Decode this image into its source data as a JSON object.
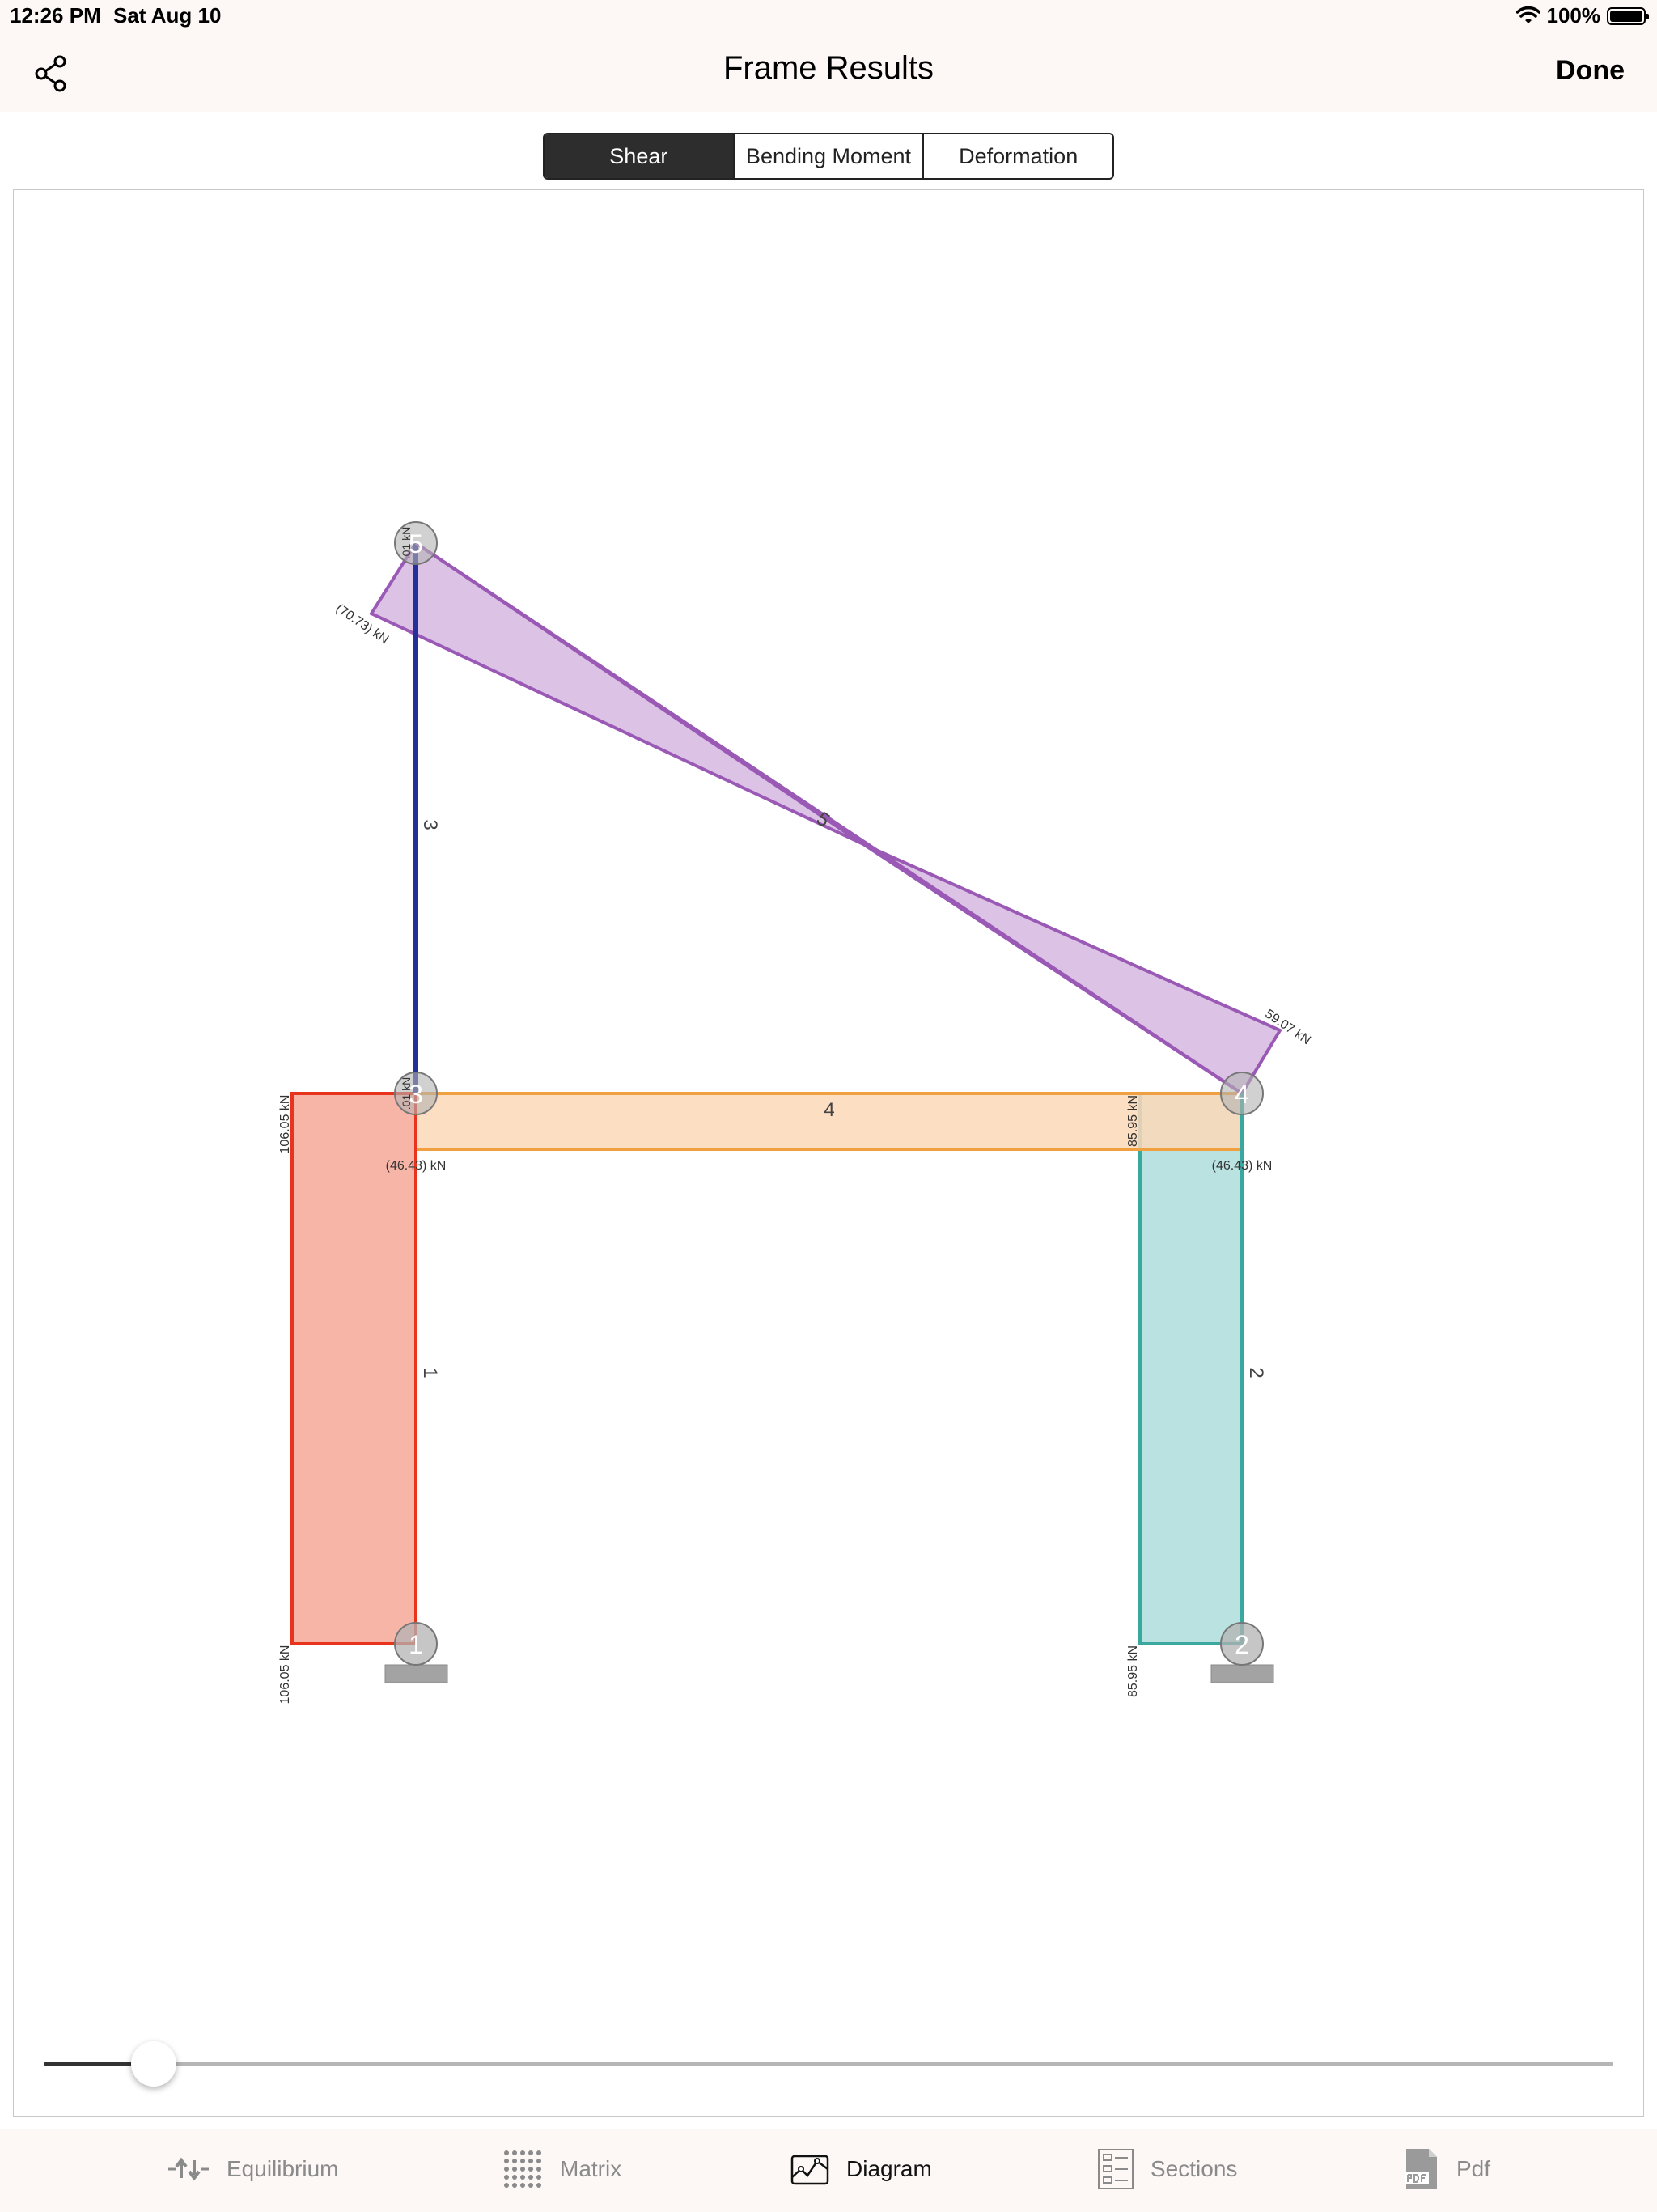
{
  "status": {
    "time": "12:26 PM",
    "date": "Sat Aug 10",
    "battery": "100%",
    "battery_level": 1.0
  },
  "nav": {
    "title": "Frame Results",
    "done_label": "Done"
  },
  "segments": [
    {
      "label": "Shear",
      "active": true
    },
    {
      "label": "Bending Moment",
      "active": false
    },
    {
      "label": "Deformation",
      "active": false
    }
  ],
  "diagram": {
    "member_labels": {
      "m1": "1",
      "m2": "2",
      "m3": "3",
      "m4": "4",
      "m5": "5"
    },
    "node_labels": {
      "n1": "1",
      "n2": "2",
      "n3": "3",
      "n4": "4",
      "n5": "5"
    },
    "values": {
      "m1_top": "106.05 kN",
      "m1_bottom": "106.05 kN",
      "m2_top": "85.95 kN",
      "m2_bottom": "85.95 kN",
      "m4_left": "(46.43) kN",
      "m4_right": "(46.43) kN",
      "m5_left": "(70.73) kN",
      "m5_right": "59.07 kN",
      "m3_top": ".01 kN",
      "m3_bottom": ".01 kN"
    },
    "colors": {
      "member1": "#e8341c",
      "member1_fill": "#f7b5a8",
      "member2": "#3aa89e",
      "member2_fill": "#bae2e0",
      "member3": "#23309a",
      "member4": "#f0a040",
      "member4_fill": "#fcd8b8",
      "member5": "#9b59b6",
      "member5_fill": "#dcc3e6"
    }
  },
  "slider": {
    "value": 0.07
  },
  "tabs": [
    {
      "label": "Equilibrium",
      "icon": "equilibrium-icon",
      "active": false
    },
    {
      "label": "Matrix",
      "icon": "matrix-icon",
      "active": false
    },
    {
      "label": "Diagram",
      "icon": "diagram-icon",
      "active": true
    },
    {
      "label": "Sections",
      "icon": "sections-icon",
      "active": false
    },
    {
      "label": "Pdf",
      "icon": "pdf-icon",
      "active": false
    }
  ]
}
